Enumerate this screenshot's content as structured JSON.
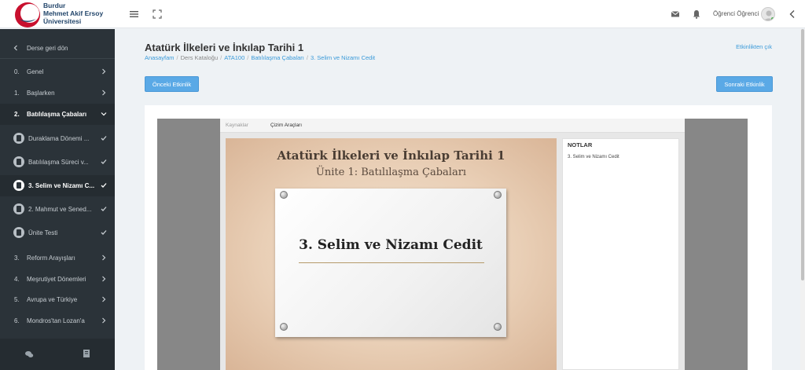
{
  "header": {
    "uni_line1": "Burdur",
    "uni_line2": "Mehmet Akif Ersoy",
    "uni_line3": "Üniversitesi",
    "user_name": "Öğrenci Öğrenci",
    "icons": [
      "menu-icon",
      "fullscreen-icon",
      "envelope-icon",
      "bell-icon",
      "chevron-left-icon"
    ]
  },
  "sidebar": {
    "back_label": "Derse geri dön",
    "items": [
      {
        "num": "0.",
        "label": "Genel"
      },
      {
        "num": "1.",
        "label": "Başlarken"
      },
      {
        "num": "2.",
        "label": "Batılılaşma Çabaları"
      },
      {
        "num": "",
        "label": "Duraklama Dönemi ..."
      },
      {
        "num": "",
        "label": "Batılılaşma Süreci v..."
      },
      {
        "num": "",
        "label": "3. Selim ve Nizamı C..."
      },
      {
        "num": "",
        "label": "2. Mahmut ve Sened..."
      },
      {
        "num": "",
        "label": "Ünite Testi"
      },
      {
        "num": "3.",
        "label": "Reform Arayışları"
      },
      {
        "num": "4.",
        "label": "Meşrutiyet Dönemleri"
      },
      {
        "num": "5.",
        "label": "Avrupa ve Türkiye"
      },
      {
        "num": "6.",
        "label": "Mondros'tan Lozan'a"
      }
    ]
  },
  "main": {
    "title": "Atatürk İlkeleri ve İnkılap Tarihi 1",
    "breadcrumb": [
      "Anasayfam",
      "Ders Kataloğu",
      "ATA100",
      "Batılılaşma Çabaları",
      "3. Selim ve Nizamı Cedit"
    ],
    "exit_label": "Etkinlikten çık",
    "prev_label": "Önceki Etkinlik",
    "next_label": "Sonraki Etkinlik"
  },
  "player": {
    "tab_resources": "Kaynaklar",
    "tab_tools": "Çizim Araçları",
    "slide_title": "Atatürk İlkeleri ve İnkılap Tarihi 1",
    "slide_subtitle": "Ünite 1: Batılılaşma Çabaları",
    "slide_heading": "3. Selim ve Nizamı Cedit",
    "notes_title": "NOTLAR",
    "notes_item": "3. Selim ve Nizamı Cedit"
  },
  "colors": {
    "sidebar_bg": "#2b3339",
    "accent": "#5aa9e6",
    "link": "#3a9ad9"
  }
}
